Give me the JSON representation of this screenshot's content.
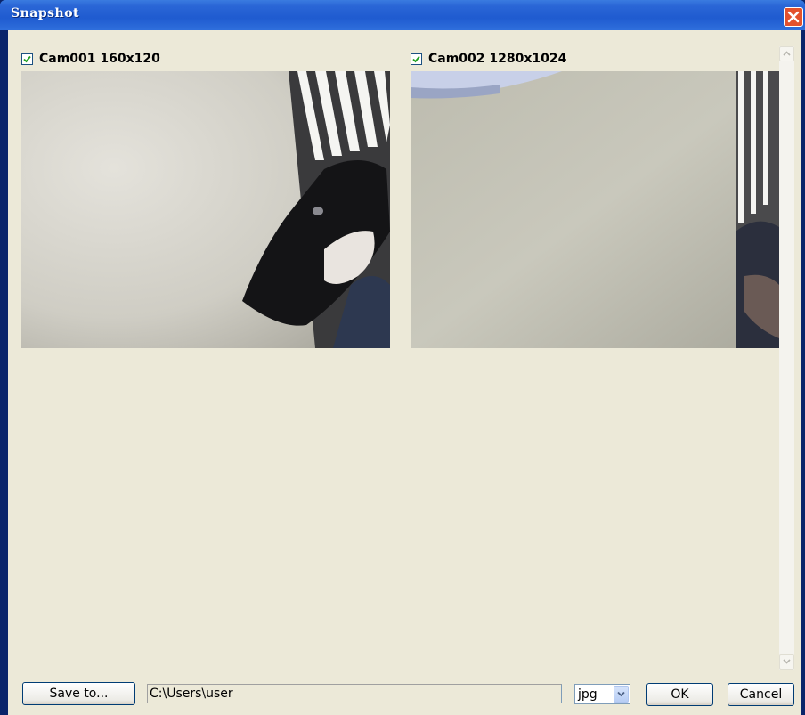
{
  "window": {
    "title": "Snapshot"
  },
  "cameras": [
    {
      "label": "Cam001 160x120",
      "checked": true
    },
    {
      "label": "Cam002 1280x1024",
      "checked": true
    }
  ],
  "bottom_bar": {
    "save_to_label": "Save to...",
    "path_value": "C:\\Users\\user",
    "format_value": "jpg",
    "ok_label": "OK",
    "cancel_label": "Cancel"
  }
}
